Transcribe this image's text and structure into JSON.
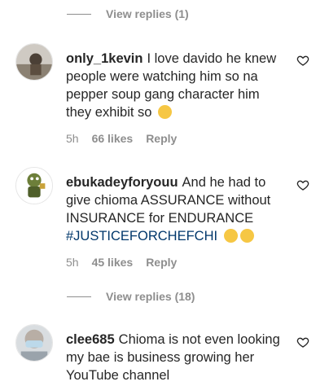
{
  "view_replies_top": "View replies (1)",
  "view_replies_mid": "View replies (18)",
  "comments": [
    {
      "username": "only_1kevin",
      "text": "I love davido he knew people were watching him so na pepper soup gang character him they exhibit so",
      "emoji": "grinning-sweat-emoji",
      "time": "5h",
      "likes": "66 likes",
      "reply": "Reply"
    },
    {
      "username": "ebukadeyforyouu",
      "text": "And he had to give chioma ASSURANCE without INSURANCE for ENDURANCE",
      "hashtag": "#JUSTICEFORCHEFCHI",
      "emoji": "grinning-sweat-emoji",
      "emoji2": "disappointed-emoji",
      "time": "5h",
      "likes": "45 likes",
      "reply": "Reply"
    },
    {
      "username": "clee685",
      "text": "Chioma is not even looking my bae is business growing her YouTube channel"
    }
  ],
  "colors": {
    "text": "#262626",
    "muted": "#8e8e8e",
    "hashtag": "#00376b",
    "emoji": "#f6c744"
  }
}
